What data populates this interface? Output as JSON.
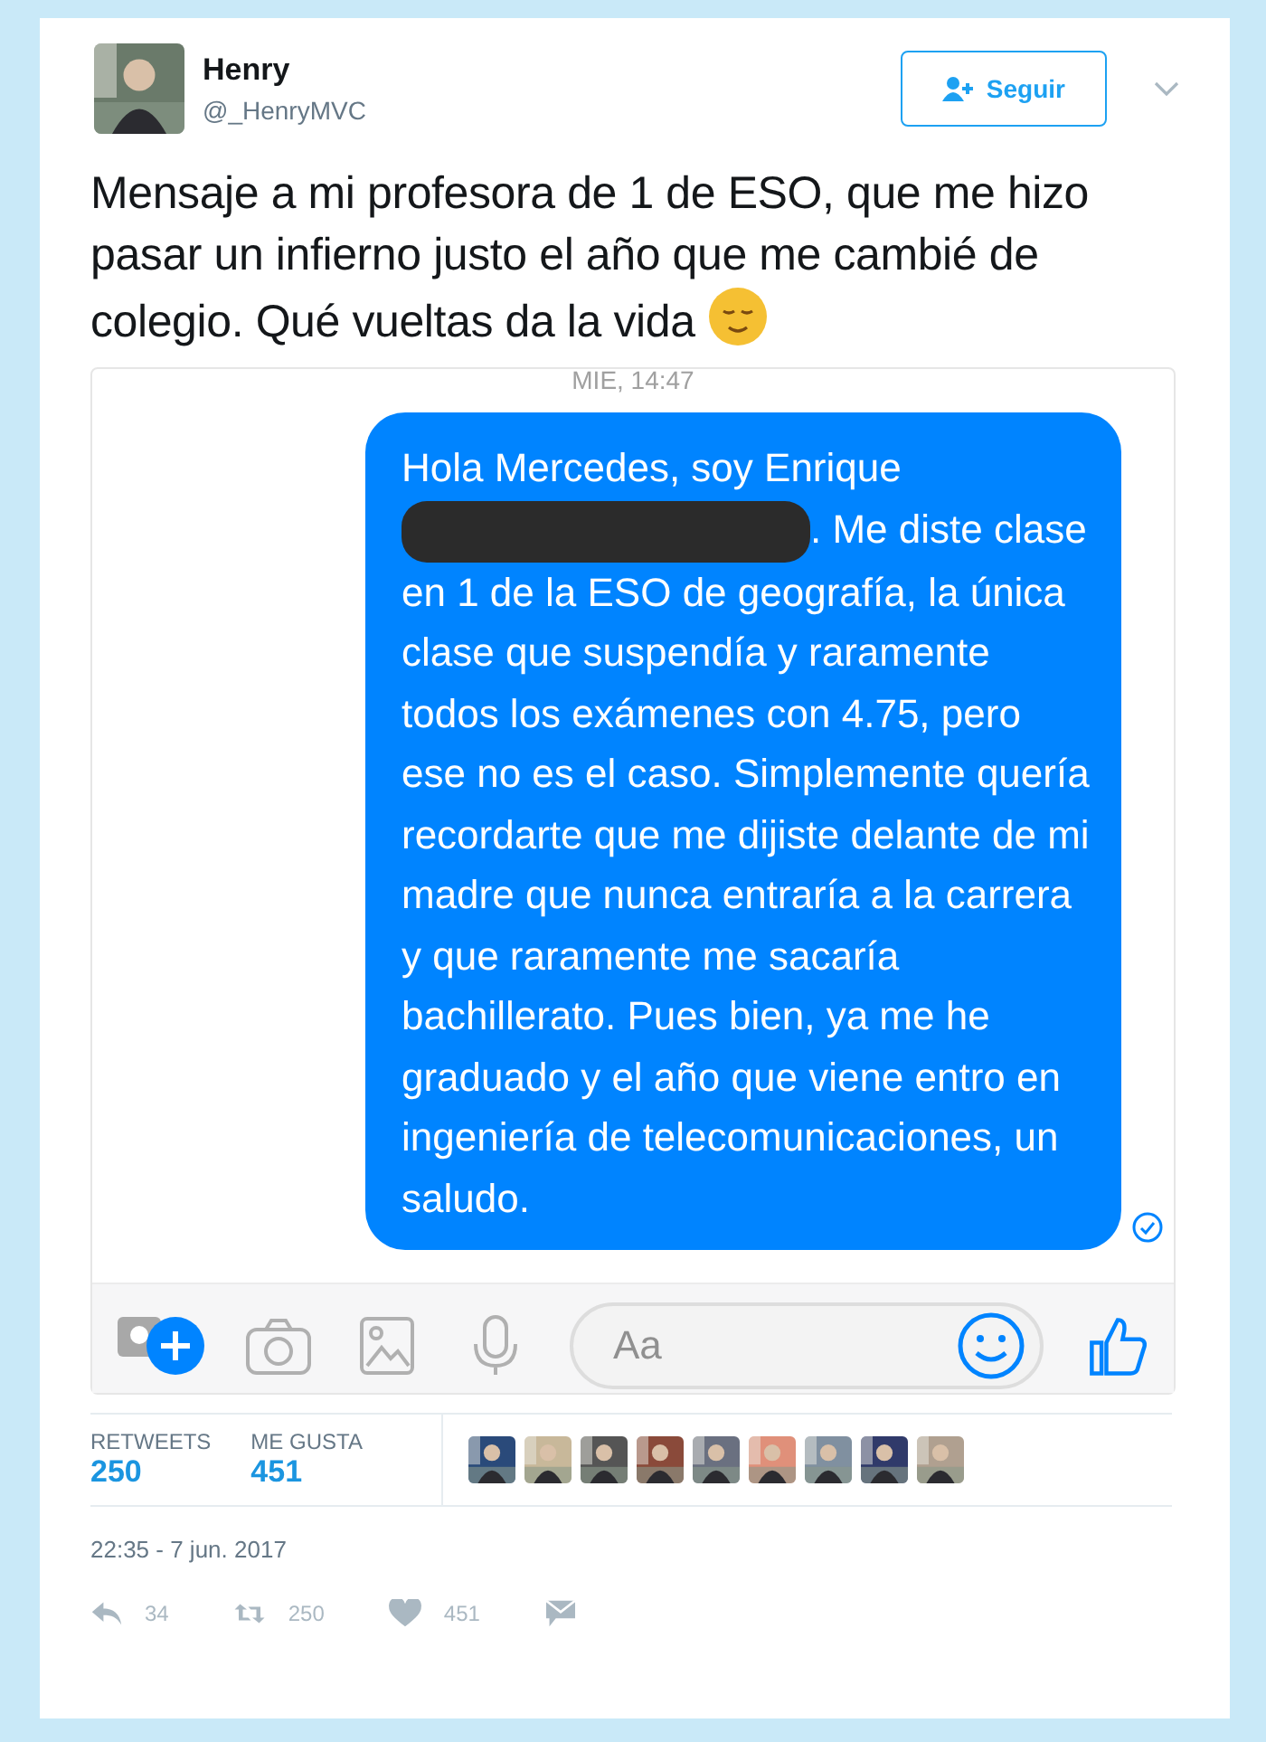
{
  "tweet": {
    "name": "Henry",
    "handle": "@_HenryMVC",
    "follow_button": "Seguir",
    "text": "Mensaje a mi profesora de 1 de ESO, que me hizo pasar un infierno justo el año que me cambié de colegio. Qué vueltas da la vida",
    "embedded": {
      "timestamp": "MIE, 14:47",
      "message_before": "Hola Mercedes, soy Enrique",
      "message_after": ". Me diste clase en 1 de la ESO de geografía, la única clase que suspendía y raramente todos los exámenes con 4.75, pero ese no es el caso. Simplemente quería recordarte que me dijiste delante de mi madre que nunca entraría a la carrera y que raramente me sacaría bachillerato. Pues bien, ya me he graduado y el año que viene entro en ingeniería de telecomunicaciones, un saludo.",
      "composer_placeholder": "Aa"
    },
    "stats": [
      {
        "label": "RETWEETS",
        "value": "250"
      },
      {
        "label": "ME GUSTA",
        "value": "451"
      }
    ],
    "date": "22:35 - 7 jun. 2017",
    "actions": [
      {
        "kind": "reply",
        "count": "34"
      },
      {
        "kind": "retweet",
        "count": "250"
      },
      {
        "kind": "like",
        "count": "451"
      },
      {
        "kind": "message"
      }
    ]
  }
}
